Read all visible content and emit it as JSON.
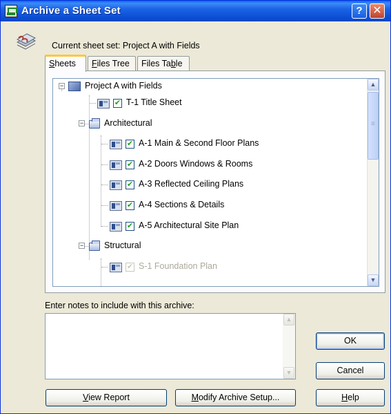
{
  "window": {
    "title": "Archive a Sheet Set",
    "help_button": "?",
    "close_button": "✕"
  },
  "current_sheet_set": {
    "label": "Current sheet set: Project A with Fields"
  },
  "tabs": [
    {
      "label": "Sheets",
      "mnemonic_index": 0,
      "active": true
    },
    {
      "label": "Files Tree",
      "mnemonic_index": 0,
      "active": false
    },
    {
      "label": "Files Table",
      "mnemonic_index": 8,
      "active": false
    }
  ],
  "tree": {
    "root": {
      "label": "Project A with Fields",
      "expanded": true,
      "icon": "sheet-set-icon"
    },
    "items": [
      {
        "label": "T-1 Title Sheet",
        "type": "sheet",
        "checked": true,
        "disabled": false
      },
      {
        "label": "Architectural",
        "type": "subset",
        "expanded": true
      },
      {
        "label": "A-1 Main & Second Floor Plans",
        "type": "sheet",
        "checked": true,
        "disabled": false
      },
      {
        "label": "A-2 Doors Windows & Rooms",
        "type": "sheet",
        "checked": true,
        "disabled": false
      },
      {
        "label": "A-3 Reflected Ceiling Plans",
        "type": "sheet",
        "checked": true,
        "disabled": false
      },
      {
        "label": "A-4 Sections & Details",
        "type": "sheet",
        "checked": true,
        "disabled": false
      },
      {
        "label": "A-5 Architectural Site Plan",
        "type": "sheet",
        "checked": true,
        "disabled": false
      },
      {
        "label": "Structural",
        "type": "subset",
        "expanded": true
      },
      {
        "label": "S-1 Foundation Plan",
        "type": "sheet",
        "checked": true,
        "disabled": true
      }
    ]
  },
  "notes": {
    "label": "Enter notes to include with this archive:",
    "value": ""
  },
  "buttons": {
    "ok": "OK",
    "cancel": "Cancel",
    "help": "Help",
    "view_report": "View Report",
    "modify_archive_setup": "Modify Archive Setup..."
  },
  "colors": {
    "titlebar": "#0a4fd4",
    "dialog_bg": "#ece9d8",
    "active_tab_accent": "#ffc83c",
    "check_mark": "#21a121"
  }
}
